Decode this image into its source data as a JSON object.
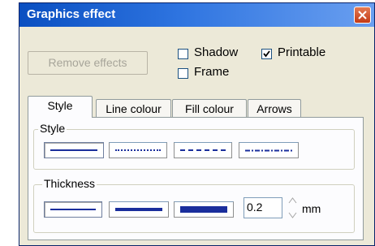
{
  "window": {
    "title": "Graphics effect"
  },
  "buttons": {
    "remove_effects": "Remove effects"
  },
  "checkboxes": [
    {
      "label": "Shadow",
      "checked": false
    },
    {
      "label": "Printable",
      "checked": true
    },
    {
      "label": "Frame",
      "checked": false
    }
  ],
  "tabs": [
    "Style",
    "Line colour",
    "Fill colour",
    "Arrows"
  ],
  "active_tab": "Style",
  "style_group": {
    "label": "Style",
    "options": [
      "solid",
      "dotted",
      "dashed",
      "dash-dot"
    ],
    "selected": "solid"
  },
  "thickness_group": {
    "label": "Thickness",
    "options": [
      "thin",
      "medium",
      "thick"
    ],
    "selected": "thin",
    "value": "0.2",
    "unit": "mm"
  },
  "colors": {
    "line": "#1a2e9c",
    "title_bar": "#0a4fc1"
  }
}
